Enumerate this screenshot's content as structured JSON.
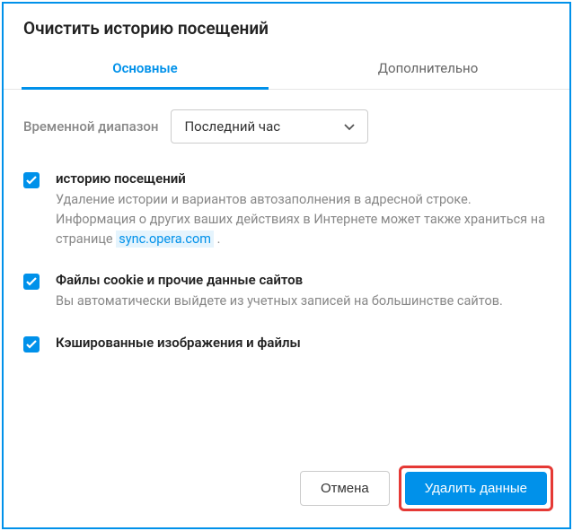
{
  "dialog": {
    "title": "Очистить историю посещений"
  },
  "tabs": {
    "basic": "Основные",
    "advanced": "Дополнительно"
  },
  "time": {
    "label": "Временной диапазон",
    "selected": "Последний час"
  },
  "options": {
    "history": {
      "title": "историю посещений",
      "desc_before": "Удаление истории и вариантов автозаполнения в адресной строке. Информация о других ваших действиях в Интернете может также храниться на странице ",
      "link": "sync.opera.com",
      "desc_after": " ."
    },
    "cookies": {
      "title": "Файлы cookie и прочие данные сайтов",
      "desc": "Вы автоматически выйдете из учетных записей на большинстве сайтов."
    },
    "cache": {
      "title": "Кэшированные изображения и файлы"
    }
  },
  "buttons": {
    "cancel": "Отмена",
    "confirm": "Удалить данные"
  }
}
